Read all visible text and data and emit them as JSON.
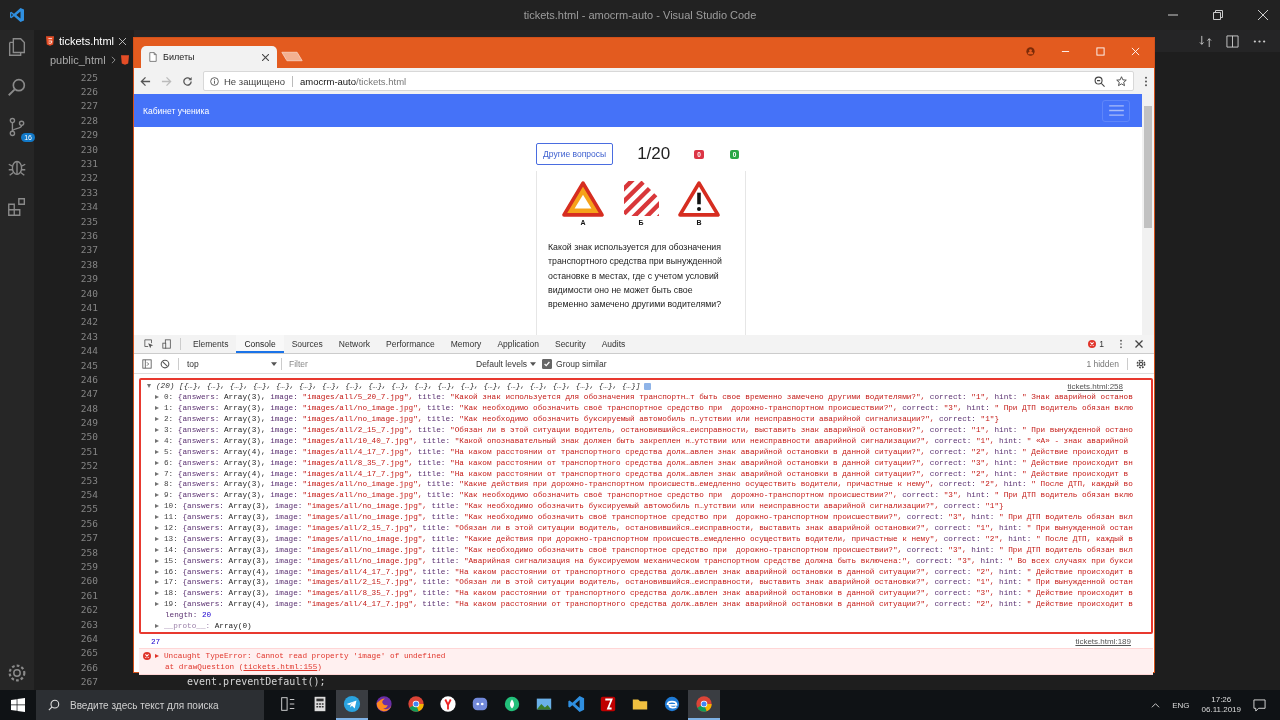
{
  "vscode": {
    "title": "tickets.html - amocrm-auto - Visual Studio Code",
    "scm_badge": "16",
    "tab": "tickets.html",
    "breadcrumb": "public_html",
    "lines": [
      {
        "number": "225"
      },
      {
        "number": "226"
      },
      {
        "number": "227"
      },
      {
        "number": "228"
      },
      {
        "number": "229"
      },
      {
        "number": "230"
      },
      {
        "number": "231"
      },
      {
        "number": "232"
      },
      {
        "number": "233"
      },
      {
        "number": "234"
      },
      {
        "number": "235"
      },
      {
        "number": "236"
      },
      {
        "number": "237"
      },
      {
        "number": "238"
      },
      {
        "number": "239"
      },
      {
        "number": "240"
      },
      {
        "number": "241"
      },
      {
        "number": "242"
      },
      {
        "number": "243"
      },
      {
        "number": "244"
      },
      {
        "number": "245"
      },
      {
        "number": "246"
      },
      {
        "number": "247"
      },
      {
        "number": "248"
      },
      {
        "number": "249"
      },
      {
        "number": "250"
      },
      {
        "number": "251"
      },
      {
        "number": "252"
      },
      {
        "number": "253"
      },
      {
        "number": "254"
      },
      {
        "number": "255"
      },
      {
        "number": "256"
      },
      {
        "number": "257"
      },
      {
        "number": "258"
      },
      {
        "number": "259"
      },
      {
        "number": "260"
      },
      {
        "number": "261"
      },
      {
        "number": "262"
      },
      {
        "number": "263"
      },
      {
        "number": "264"
      },
      {
        "number": "265"
      },
      {
        "number": "266"
      },
      {
        "number": "267",
        "code": "event.preventDefault();"
      }
    ]
  },
  "browser": {
    "tab": "Билеты",
    "security": "Не защищено",
    "url_host": "amocrm-auto",
    "url_path": "/tickets.html"
  },
  "page": {
    "brand": "Кабинет ученика",
    "other_button": "Другие вопросы",
    "counter": "1/20",
    "badges": [
      {
        "text": "0",
        "color": "#dc3545"
      },
      {
        "text": "0",
        "color": "#28a745"
      }
    ],
    "signs": [
      {
        "kind": "triangle",
        "label": "А"
      },
      {
        "kind": "stripes",
        "label": "Б"
      },
      {
        "kind": "exclamation",
        "label": "В"
      }
    ],
    "question": "Какой знак используется для обозначения транспортного средства при вынужденной остановке в местах, где с учетом условий видимости оно не может быть свое временно замечено другими водителями?"
  },
  "devtools": {
    "tabs": [
      {
        "label": "Elements",
        "selected": false
      },
      {
        "label": "Console",
        "selected": true
      },
      {
        "label": "Sources",
        "selected": false
      },
      {
        "label": "Network",
        "selected": false
      },
      {
        "label": "Performance",
        "selected": false
      },
      {
        "label": "Memory",
        "selected": false
      },
      {
        "label": "Application",
        "selected": false
      },
      {
        "label": "Security",
        "selected": false
      },
      {
        "label": "Audits",
        "selected": false
      }
    ],
    "error_count": "1",
    "context": "top",
    "filter_placeholder": "Filter",
    "levels": "Default levels",
    "group_similar": {
      "label": "Group similar",
      "checked": true
    },
    "hidden": "1 hidden"
  },
  "console": {
    "summary": "(20) [{…}, {…}, {…}, {…}, {…}, {…}, {…}, {…}, {…}, {…}, {…}, {…}, {…}, {…}, {…}, {…}, {…}, {…}, {…}, {…}]",
    "source": "tickets.html:258",
    "rows": [
      {
        "index": "0:",
        "parts": [
          {
            "key": "{answers:",
            "value": "Array(3),",
            "kind": "object"
          },
          {
            "key": "image:",
            "value": "\"images/all/5_20_7.jpg\",",
            "kind": "string"
          },
          {
            "key": "title:",
            "value": "\"Какой знак используется для обозначения транспортн…т быть свое временно замечено другими водителями?\",",
            "kind": "string"
          },
          {
            "key": "correct:",
            "value": "\"1\",",
            "kind": "string"
          },
          {
            "key": "hint:",
            "value": "\" Знак аварийной останов",
            "kind": "string"
          }
        ]
      },
      {
        "index": "1:",
        "parts": [
          {
            "key": "{answers:",
            "value": "Array(3),",
            "kind": "object"
          },
          {
            "key": "image:",
            "value": "\"images/all/no_image.jpg\",",
            "kind": "string"
          },
          {
            "key": "title:",
            "value": "\"Как необходимо обозначить своё транспортное средство при  дорожно-транспортном происшествии?\",",
            "kind": "string"
          },
          {
            "key": "correct:",
            "value": "\"3\",",
            "kind": "string"
          },
          {
            "key": "hint:",
            "value": "\" При ДТП водитель обязан вклю",
            "kind": "string"
          }
        ]
      },
      {
        "index": "2:",
        "parts": [
          {
            "key": "{answers:",
            "value": "Array(3),",
            "kind": "object"
          },
          {
            "key": "image:",
            "value": "\"images/all/no_image.jpg\",",
            "kind": "string"
          },
          {
            "key": "title:",
            "value": "\"Как необходимо обозначить буксируемый автомобиль п…утствии или неисправности аварийной сигнализации?\",",
            "kind": "string"
          },
          {
            "key": "correct:",
            "value": "\"1\"}",
            "kind": "string"
          }
        ]
      },
      {
        "index": "3:",
        "parts": [
          {
            "key": "{answers:",
            "value": "Array(3),",
            "kind": "object"
          },
          {
            "key": "image:",
            "value": "\"images/all/2_15_7.jpg\",",
            "kind": "string"
          },
          {
            "key": "title:",
            "value": "\"Обязан ли в этой ситуации водитель, остановившийся…еисправности, выставить знак аварийной остановки?\",",
            "kind": "string"
          },
          {
            "key": "correct:",
            "value": "\"1\",",
            "kind": "string"
          },
          {
            "key": "hint:",
            "value": "\" При вынужденной остано",
            "kind": "string"
          }
        ]
      },
      {
        "index": "4:",
        "parts": [
          {
            "key": "{answers:",
            "value": "Array(3),",
            "kind": "object"
          },
          {
            "key": "image:",
            "value": "\"images/all/10_40_7.jpg\",",
            "kind": "string"
          },
          {
            "key": "title:",
            "value": "\"Какой опознавательный знак должен быть закреплен н…утствии или неисправности аварийной сигнализации?\",",
            "kind": "string"
          },
          {
            "key": "correct:",
            "value": "\"1\",",
            "kind": "string"
          },
          {
            "key": "hint:",
            "value": "\" «А» - знак аварийной",
            "kind": "string"
          }
        ]
      },
      {
        "index": "5:",
        "parts": [
          {
            "key": "{answers:",
            "value": "Array(4),",
            "kind": "object"
          },
          {
            "key": "image:",
            "value": "\"images/all/4_17_7.jpg\",",
            "kind": "string"
          },
          {
            "key": "title:",
            "value": "\"На каком расстоянии от транспортного средства долж…авлен знак аварийной остановки в данной ситуации?\",",
            "kind": "string"
          },
          {
            "key": "correct:",
            "value": "\"2\",",
            "kind": "string"
          },
          {
            "key": "hint:",
            "value": "\" Действие происходит в",
            "kind": "string"
          }
        ]
      },
      {
        "index": "6:",
        "parts": [
          {
            "key": "{answers:",
            "value": "Array(3),",
            "kind": "object"
          },
          {
            "key": "image:",
            "value": "\"images/all/8_35_7.jpg\",",
            "kind": "string"
          },
          {
            "key": "title:",
            "value": "\"На каком расстоянии от транспортного средства долж…авлен знак аварийной остановки в данной ситуации?\",",
            "kind": "string"
          },
          {
            "key": "correct:",
            "value": "\"3\",",
            "kind": "string"
          },
          {
            "key": "hint:",
            "value": "\" Действие происходит вн",
            "kind": "string"
          }
        ]
      },
      {
        "index": "7:",
        "parts": [
          {
            "key": "{answers:",
            "value": "Array(4),",
            "kind": "object"
          },
          {
            "key": "image:",
            "value": "\"images/all/4_17_7.jpg\",",
            "kind": "string"
          },
          {
            "key": "title:",
            "value": "\"На каком расстоянии от транспортного средства долж…авлен знак аварийной остановки в данной ситуации?\",",
            "kind": "string"
          },
          {
            "key": "correct:",
            "value": "\"2\",",
            "kind": "string"
          },
          {
            "key": "hint:",
            "value": "\" Действие происходит в",
            "kind": "string"
          }
        ]
      },
      {
        "index": "8:",
        "parts": [
          {
            "key": "{answers:",
            "value": "Array(3),",
            "kind": "object"
          },
          {
            "key": "image:",
            "value": "\"images/all/no_image.jpg\",",
            "kind": "string"
          },
          {
            "key": "title:",
            "value": "\"Какие действия при дорожно-транспортном происшеств…емедленно осуществить водители, причастные к нему\",",
            "kind": "string"
          },
          {
            "key": "correct:",
            "value": "\"2\",",
            "kind": "string"
          },
          {
            "key": "hint:",
            "value": "\" После ДТП, каждый во",
            "kind": "string"
          }
        ]
      },
      {
        "index": "9:",
        "parts": [
          {
            "key": "{answers:",
            "value": "Array(3),",
            "kind": "object"
          },
          {
            "key": "image:",
            "value": "\"images/all/no_image.jpg\",",
            "kind": "string"
          },
          {
            "key": "title:",
            "value": "\"Как необходимо обозначить своё транспортное средство при  дорожно-транспортном происшествии?\",",
            "kind": "string"
          },
          {
            "key": "correct:",
            "value": "\"3\",",
            "kind": "string"
          },
          {
            "key": "hint:",
            "value": "\" При ДТП водитель обязан вклю",
            "kind": "string"
          }
        ]
      },
      {
        "index": "10:",
        "parts": [
          {
            "key": "{answers:",
            "value": "Array(3),",
            "kind": "object"
          },
          {
            "key": "image:",
            "value": "\"images/all/no_image.jpg\",",
            "kind": "string"
          },
          {
            "key": "title:",
            "value": "\"Как необходимо обозначить буксируемый автомобиль п…утствии или неисправности аварийной сигнализации?\",",
            "kind": "string"
          },
          {
            "key": "correct:",
            "value": "\"1\"}",
            "kind": "string"
          }
        ]
      },
      {
        "index": "11:",
        "parts": [
          {
            "key": "{answers:",
            "value": "Array(3),",
            "kind": "object"
          },
          {
            "key": "image:",
            "value": "\"images/all/no_image.jpg\",",
            "kind": "string"
          },
          {
            "key": "title:",
            "value": "\"Как необходимо обозначить своё транспортное средство при  дорожно-транспортном происшествии?\",",
            "kind": "string"
          },
          {
            "key": "correct:",
            "value": "\"3\",",
            "kind": "string"
          },
          {
            "key": "hint:",
            "value": "\" При ДТП водитель обязан вкл",
            "kind": "string"
          }
        ]
      },
      {
        "index": "12:",
        "parts": [
          {
            "key": "{answers:",
            "value": "Array(3),",
            "kind": "object"
          },
          {
            "key": "image:",
            "value": "\"images/all/2_15_7.jpg\",",
            "kind": "string"
          },
          {
            "key": "title:",
            "value": "\"Обязан ли в этой ситуации водитель, остановившийся…еисправности, выставить знак аварийной остановки?\",",
            "kind": "string"
          },
          {
            "key": "correct:",
            "value": "\"1\",",
            "kind": "string"
          },
          {
            "key": "hint:",
            "value": "\" При вынужденной остан",
            "kind": "string"
          }
        ]
      },
      {
        "index": "13:",
        "parts": [
          {
            "key": "{answers:",
            "value": "Array(3),",
            "kind": "object"
          },
          {
            "key": "image:",
            "value": "\"images/all/no_image.jpg\",",
            "kind": "string"
          },
          {
            "key": "title:",
            "value": "\"Какие действия при дорожно-транспортном происшеств…емедленно осуществить водители, причастные к нему\",",
            "kind": "string"
          },
          {
            "key": "correct:",
            "value": "\"2\",",
            "kind": "string"
          },
          {
            "key": "hint:",
            "value": "\" После ДТП, каждый в",
            "kind": "string"
          }
        ]
      },
      {
        "index": "14:",
        "parts": [
          {
            "key": "{answers:",
            "value": "Array(3),",
            "kind": "object"
          },
          {
            "key": "image:",
            "value": "\"images/all/no_image.jpg\",",
            "kind": "string"
          },
          {
            "key": "title:",
            "value": "\"Как необходимо обозначить своё транспортное средство при  дорожно-транспортном происшествии?\",",
            "kind": "string"
          },
          {
            "key": "correct:",
            "value": "\"3\",",
            "kind": "string"
          },
          {
            "key": "hint:",
            "value": "\" При ДТП водитель обязан вкл",
            "kind": "string"
          }
        ]
      },
      {
        "index": "15:",
        "parts": [
          {
            "key": "{answers:",
            "value": "Array(3),",
            "kind": "object"
          },
          {
            "key": "image:",
            "value": "\"images/all/no_image.jpg\",",
            "kind": "string"
          },
          {
            "key": "title:",
            "value": "\"Аварийная сигнализация на буксируемом механическом транспортном средстве должна быть включена:\",",
            "kind": "string"
          },
          {
            "key": "correct:",
            "value": "\"3\",",
            "kind": "string"
          },
          {
            "key": "hint:",
            "value": "\" Во всех случаях при букси",
            "kind": "string"
          }
        ]
      },
      {
        "index": "16:",
        "parts": [
          {
            "key": "{answers:",
            "value": "Array(4),",
            "kind": "object"
          },
          {
            "key": "image:",
            "value": "\"images/all/4_17_7.jpg\",",
            "kind": "string"
          },
          {
            "key": "title:",
            "value": "\"На каком расстоянии от транспортного средства долж…авлен знак аварийной остановки в данной ситуации?\",",
            "kind": "string"
          },
          {
            "key": "correct:",
            "value": "\"2\",",
            "kind": "string"
          },
          {
            "key": "hint:",
            "value": "\" Действие происходит в",
            "kind": "string"
          }
        ]
      },
      {
        "index": "17:",
        "parts": [
          {
            "key": "{answers:",
            "value": "Array(3),",
            "kind": "object"
          },
          {
            "key": "image:",
            "value": "\"images/all/2_15_7.jpg\",",
            "kind": "string"
          },
          {
            "key": "title:",
            "value": "\"Обязан ли в этой ситуации водитель, остановившийся…еисправности, выставить знак аварийной остановки?\",",
            "kind": "string"
          },
          {
            "key": "correct:",
            "value": "\"1\",",
            "kind": "string"
          },
          {
            "key": "hint:",
            "value": "\" При вынужденной остан",
            "kind": "string"
          }
        ]
      },
      {
        "index": "18:",
        "parts": [
          {
            "key": "{answers:",
            "value": "Array(3),",
            "kind": "object"
          },
          {
            "key": "image:",
            "value": "\"images/all/8_35_7.jpg\",",
            "kind": "string"
          },
          {
            "key": "title:",
            "value": "\"На каком расстоянии от транспортного средства долж…авлен знак аварийной остановки в данной ситуации?\",",
            "kind": "string"
          },
          {
            "key": "correct:",
            "value": "\"3\",",
            "kind": "string"
          },
          {
            "key": "hint:",
            "value": "\" Действие происходит в",
            "kind": "string"
          }
        ]
      },
      {
        "index": "19:",
        "parts": [
          {
            "key": "{answers:",
            "value": "Array(4),",
            "kind": "object"
          },
          {
            "key": "image:",
            "value": "\"images/all/4_17_7.jpg\",",
            "kind": "string"
          },
          {
            "key": "title:",
            "value": "\"На каком расстоянии от транспортного средства долж…авлен знак аварийной остановки в данной ситуации?\",",
            "kind": "string"
          },
          {
            "key": "correct:",
            "value": "\"2\",",
            "kind": "string"
          },
          {
            "key": "hint:",
            "value": "\" Действие происходит в",
            "kind": "string"
          }
        ]
      }
    ],
    "length_key": "length:",
    "length_value": "20",
    "proto_key": "__proto__:",
    "proto_value": "Array(0)",
    "log_value": "27",
    "log_source": "tickets.html:189",
    "error": {
      "message": "Uncaught TypeError: Cannot read property 'image' of undefined",
      "trace": "at drawQuestion (",
      "trace_link": "tickets.html:155",
      "trace_end": ")"
    }
  },
  "taskbar": {
    "search_placeholder": "Введите здесь текст для поиска",
    "apps": [
      {
        "kind": "taskview",
        "active": false
      },
      {
        "kind": "calculator",
        "active": false
      },
      {
        "kind": "telegram",
        "active": true
      },
      {
        "kind": "firefox",
        "active": false
      },
      {
        "kind": "chrome",
        "active": false
      },
      {
        "kind": "yandex",
        "active": false
      },
      {
        "kind": "discord",
        "active": false
      },
      {
        "kind": "green",
        "active": false
      },
      {
        "kind": "picture",
        "active": false
      },
      {
        "kind": "vscode",
        "active": false
      },
      {
        "kind": "filezilla",
        "active": false
      },
      {
        "kind": "folder",
        "active": false
      },
      {
        "kind": "edge",
        "active": false
      },
      {
        "kind": "chrome",
        "active": true
      }
    ],
    "language": "ENG",
    "time": "17:26",
    "date": "06.11.2019"
  }
}
